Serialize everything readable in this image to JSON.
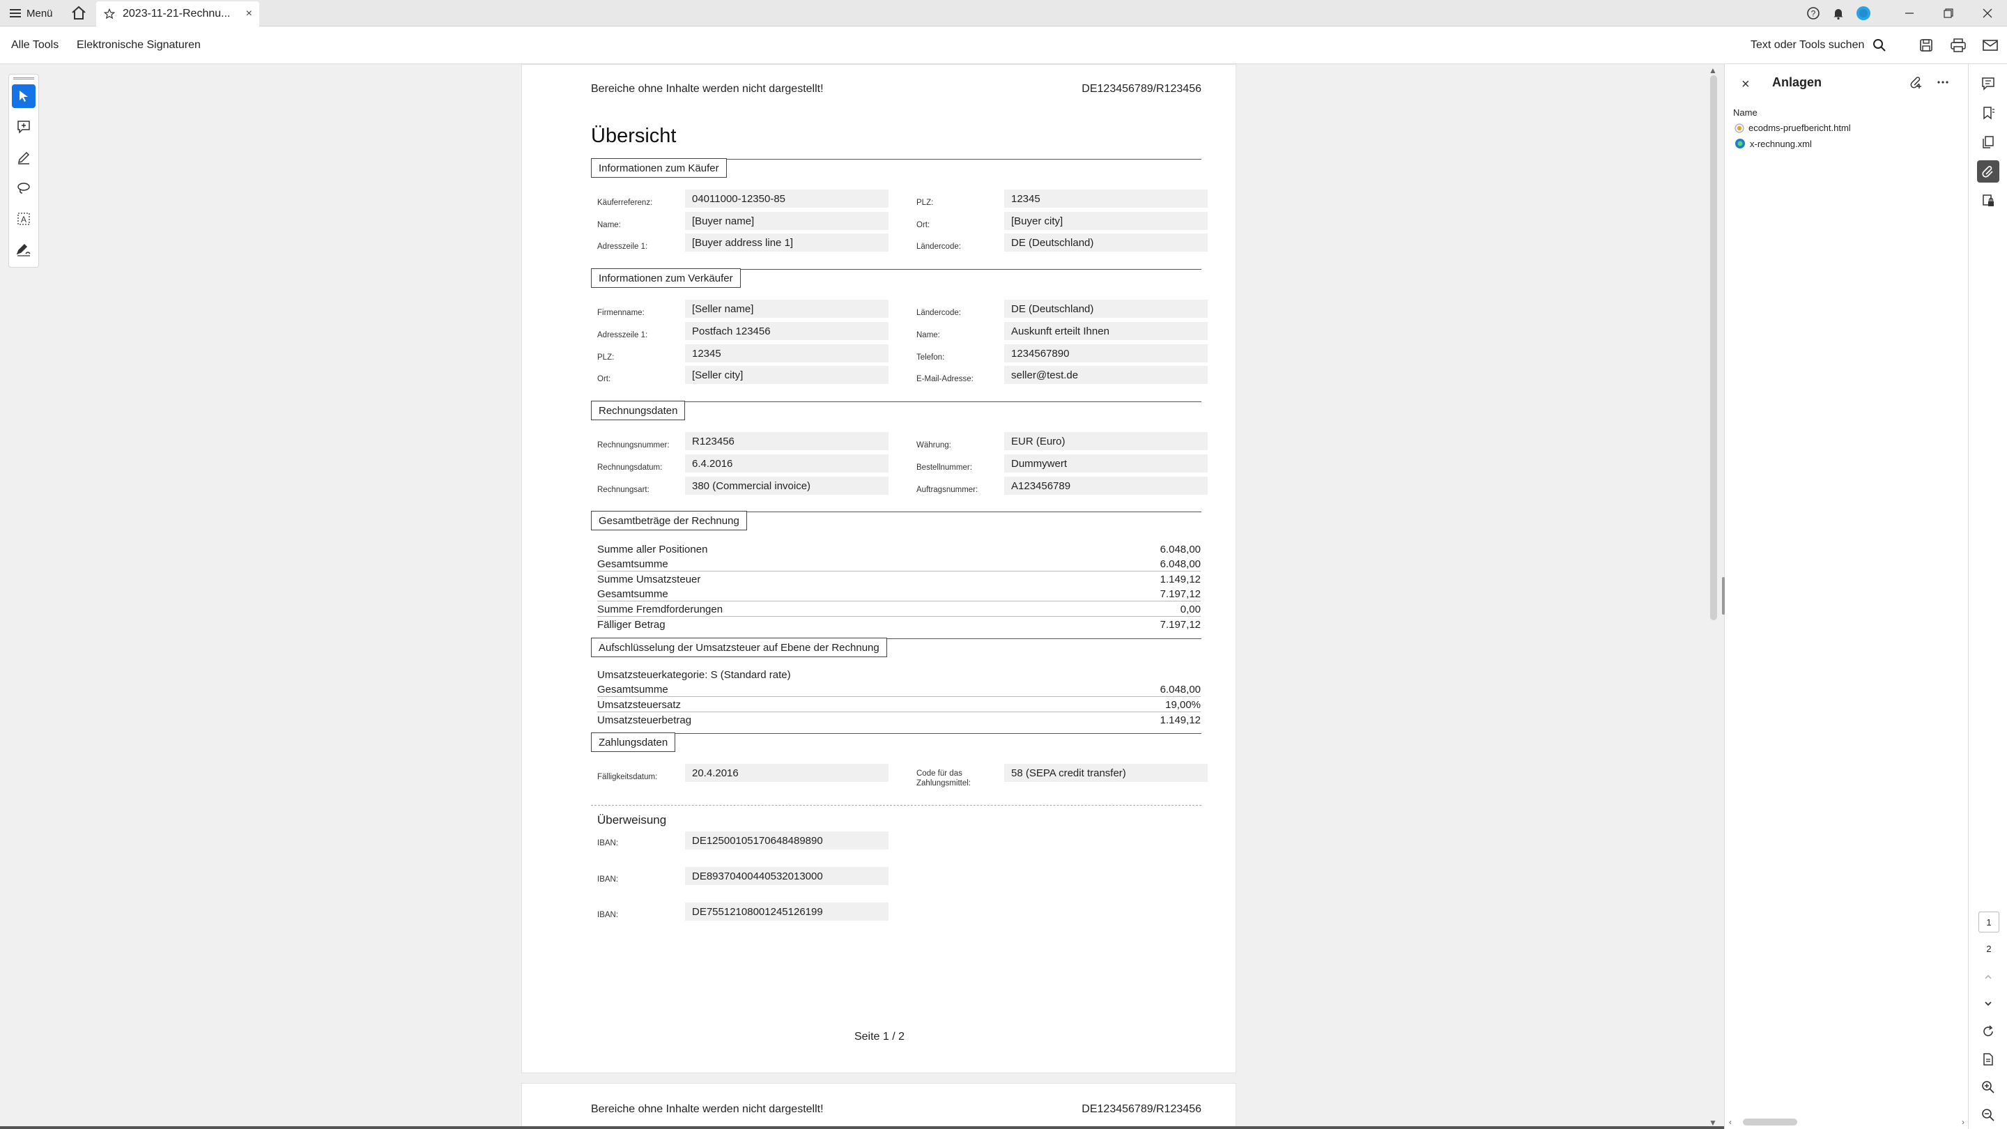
{
  "tabbar": {
    "menu_label": "Menü",
    "tab_title": "2023-11-21-Rechnu...",
    "tab_close": "×"
  },
  "toolbar": {
    "all_tools": "Alle Tools",
    "e_signatures": "Elektronische Signaturen",
    "search_label": "Text oder Tools suchen"
  },
  "document": {
    "header_left": "Bereiche ohne Inhalte werden nicht dargestellt!",
    "header_right": "DE123456789/R123456",
    "title": "Übersicht",
    "buyer": {
      "section": "Informationen zum Käufer",
      "fields": [
        {
          "label": "Käuferreferenz:",
          "value": "04011000-12350-85"
        },
        {
          "label": "Name:",
          "value": "[Buyer name]"
        },
        {
          "label": "Adresszeile 1:",
          "value": "[Buyer address line 1]"
        },
        {
          "label": "PLZ:",
          "value": "12345"
        },
        {
          "label": "Ort:",
          "value": "[Buyer city]"
        },
        {
          "label": "Ländercode:",
          "value": "DE (Deutschland)"
        }
      ]
    },
    "seller": {
      "section": "Informationen zum Verkäufer",
      "fields": [
        {
          "label": "Firmenname:",
          "value": "[Seller name]"
        },
        {
          "label": "Adresszeile 1:",
          "value": "Postfach 123456"
        },
        {
          "label": "PLZ:",
          "value": "12345"
        },
        {
          "label": "Ort:",
          "value": "[Seller city]"
        },
        {
          "label": "Ländercode:",
          "value": "DE (Deutschland)"
        },
        {
          "label": "Name:",
          "value": "Auskunft erteilt Ihnen"
        },
        {
          "label": "Telefon:",
          "value": "1234567890"
        },
        {
          "label": "E-Mail-Adresse:",
          "value": "seller@test.de"
        }
      ]
    },
    "invoice": {
      "section": "Rechnungsdaten",
      "fields": [
        {
          "label": "Rechnungsnummer:",
          "value": "R123456"
        },
        {
          "label": "Rechnungsdatum:",
          "value": "6.4.2016"
        },
        {
          "label": "Rechnungsart:",
          "value": "380 (Commercial invoice)"
        },
        {
          "label": "Währung:",
          "value": "EUR (Euro)"
        },
        {
          "label": "Bestellnummer:",
          "value": "Dummywert"
        },
        {
          "label": "Auftragsnummer:",
          "value": "A123456789"
        }
      ]
    },
    "totals": {
      "section": "Gesamtbeträge der Rechnung",
      "rows": [
        {
          "label": "Summe aller Positionen",
          "value": "6.048,00"
        },
        {
          "label": "Gesamtsumme",
          "value": "6.048,00"
        },
        {
          "label": "Summe Umsatzsteuer",
          "value": "1.149,12"
        },
        {
          "label": "Gesamtsumme",
          "value": "7.197,12"
        },
        {
          "label": "Summe Fremdforderungen",
          "value": "0,00"
        },
        {
          "label": "Fälliger Betrag",
          "value": "7.197,12"
        }
      ]
    },
    "vat": {
      "section": "Aufschlüsselung der Umsatzsteuer auf Ebene der Rechnung",
      "category": "Umsatzsteuerkategorie: S (Standard rate)",
      "rows": [
        {
          "label": "Gesamtsumme",
          "value": "6.048,00"
        },
        {
          "label": "Umsatzsteuersatz",
          "value": "19,00%"
        },
        {
          "label": "Umsatzsteuerbetrag",
          "value": "1.149,12"
        }
      ]
    },
    "payment": {
      "section": "Zahlungsdaten",
      "due_label": "Fälligkeitsdatum:",
      "due_value": "20.4.2016",
      "code_label_1": "Code für das",
      "code_label_2": "Zahlungsmittel:",
      "code_value": "58 (SEPA credit transfer)",
      "transfer_title": "Überweisung",
      "ibans": [
        {
          "label": "IBAN:",
          "value": "DE12500105170648489890"
        },
        {
          "label": "IBAN:",
          "value": "DE89370400440532013000"
        },
        {
          "label": "IBAN:",
          "value": "DE75512108001245126199"
        }
      ]
    },
    "page_number": "Seite 1 / 2",
    "page2_header_left": "Bereiche ohne Inhalte werden nicht dargestellt!",
    "page2_header_right": "DE123456789/R123456"
  },
  "attachments_panel": {
    "title": "Anlagen",
    "close": "×",
    "column_header": "Name",
    "files": [
      "ecodms-pruefbericht.html",
      "x-rechnung.xml"
    ]
  },
  "page_rail": {
    "pages": [
      "1",
      "2"
    ]
  },
  "colors": {
    "accent": "#1473e6",
    "field_bg": "#f0f0f0"
  }
}
